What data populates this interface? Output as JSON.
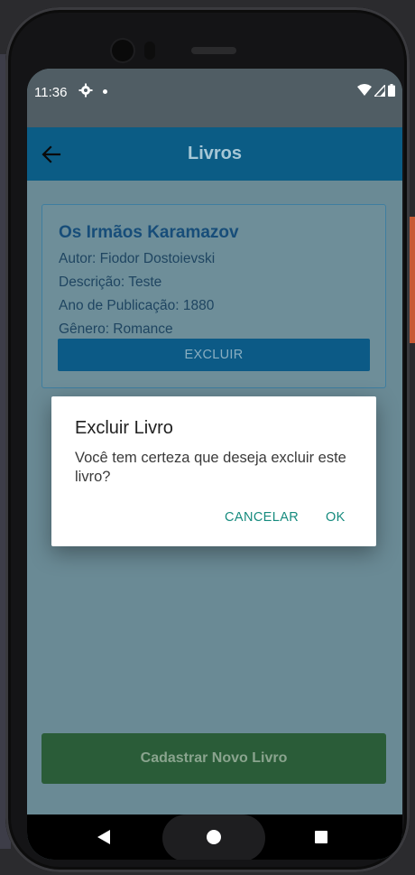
{
  "status_bar": {
    "time": "11:36"
  },
  "app_bar": {
    "title": "Livros"
  },
  "book": {
    "title": "Os Irmãos Karamazov",
    "author": "Autor: Fiodor Dostoievski",
    "description": "Descrição: Teste",
    "year": "Ano de Publicação: 1880",
    "genre": "Gênero: Romance",
    "delete_label": "EXCLUIR"
  },
  "dialog": {
    "title": "Excluir Livro",
    "message": "Você tem certeza que deseja excluir este livro?",
    "cancel_label": "CANCELAR",
    "ok_label": "OK"
  },
  "footer": {
    "register_label": "Cadastrar Novo Livro"
  },
  "colors": {
    "app_bar": "#0b5c85",
    "dialog_button": "#168b7e",
    "register_button": "#2a5c38"
  },
  "icons": {
    "back": "arrow-left-icon",
    "settings": "gear-icon",
    "wifi": "wifi-icon",
    "signal": "signal-icon",
    "battery": "battery-icon"
  }
}
